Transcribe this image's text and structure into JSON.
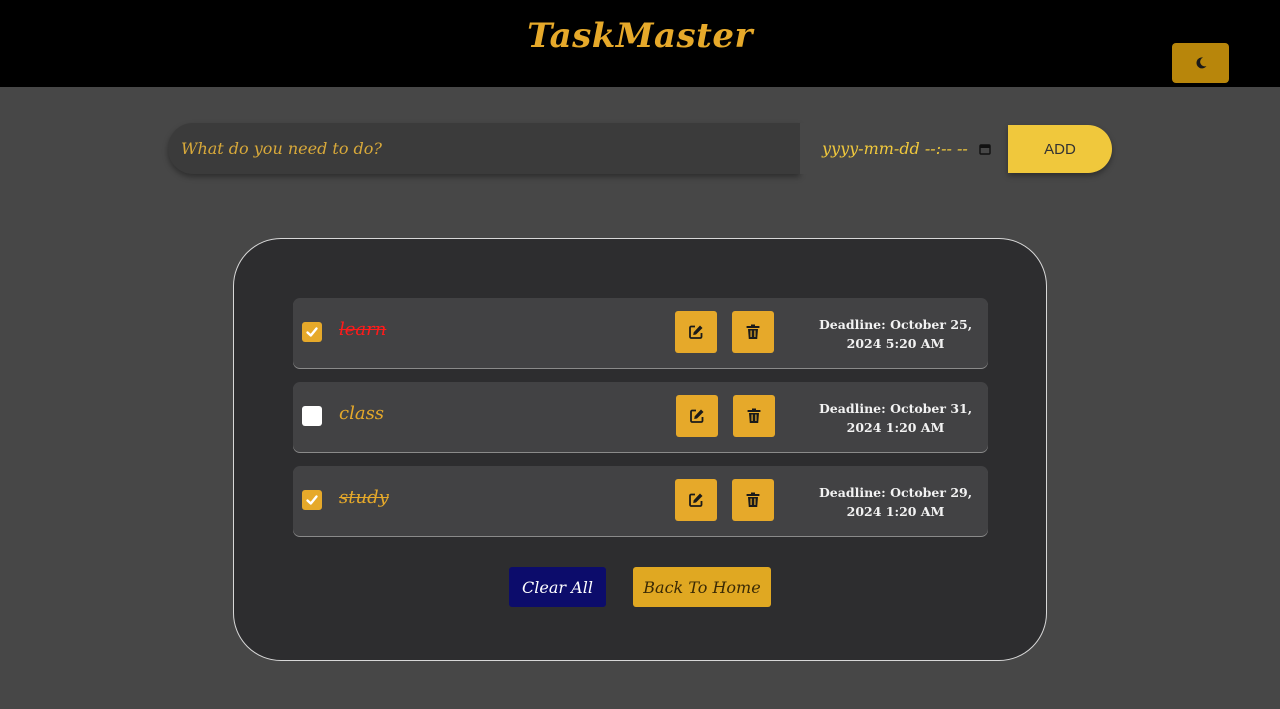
{
  "header": {
    "brand": "TaskMaster",
    "theme_toggle_icon": "moon-icon"
  },
  "form": {
    "task_placeholder": "What do you need to do?",
    "date_placeholder": "yyyy-mm-dd --:-- --",
    "add_label": "ADD"
  },
  "tasks": [
    {
      "text": "learn",
      "completed": true,
      "text_color": "#ff1a1a",
      "deadline_line1": "Deadline: October 25,",
      "deadline_line2": "2024 5:20 AM"
    },
    {
      "text": "class",
      "completed": false,
      "text_color": "#e6a92a",
      "deadline_line1": "Deadline: October 31,",
      "deadline_line2": "2024 1:20 AM"
    },
    {
      "text": "study",
      "completed": true,
      "text_color": "#e6a92a",
      "deadline_line1": "Deadline: October 29,",
      "deadline_line2": "2024 1:20 AM"
    }
  ],
  "actions": {
    "clear_label": "Clear All",
    "home_label": "Back To Home"
  },
  "colors": {
    "accent": "#e6a92a",
    "header_bg": "#000000",
    "page_bg": "#474747",
    "panel_bg": "#2d2d2f",
    "clear_button_bg": "#0c0c6b"
  }
}
